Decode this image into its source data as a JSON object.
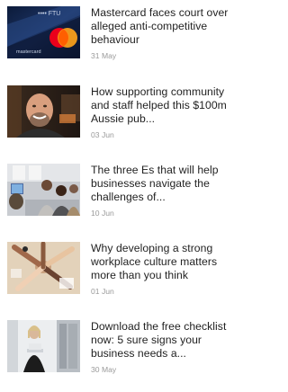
{
  "articles": [
    {
      "headline": "Mastercard faces court over\nalleged anti-competitive\nbehaviour",
      "date": "31 May",
      "image": "mastercard-card-photo"
    },
    {
      "headline": "How supporting community\nand staff helped this $100m\nAussie pub...",
      "date": "03 Jun",
      "image": "smiling-bearded-man-photo"
    },
    {
      "headline": "The three Es that will help\nbusinesses navigate the\nchallenges of...",
      "date": "10 Jun",
      "image": "office-team-meeting-photo"
    },
    {
      "headline": "Why developing a strong\nworkplace culture matters\nmore than you think",
      "date": "01 Jun",
      "image": "hands-on-table-photo"
    },
    {
      "headline": "Download the free checklist\nnow: 5 sure signs your\nbusiness needs a...",
      "date": "30 May",
      "image": "woman-with-laptop-photo"
    }
  ]
}
